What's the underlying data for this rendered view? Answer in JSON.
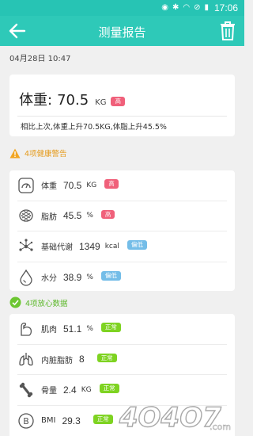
{
  "status_bar": {
    "time": "17:06"
  },
  "app_bar": {
    "title": "测量报告"
  },
  "report": {
    "datetime": "04月28日  10:47"
  },
  "summary": {
    "label": "体重:",
    "value": "70.5",
    "unit": "KG",
    "badge": "高",
    "comparison": "相比上次,体重上升70.5KG,体脂上升45.5%"
  },
  "warnings": {
    "title": "4项健康警告",
    "items": [
      {
        "name": "体重",
        "value": "70.5",
        "unit": "KG",
        "badge": "高",
        "badge_color": "#f0607a",
        "icon": "gauge-icon"
      },
      {
        "name": "脂肪",
        "value": "45.5",
        "unit": "%",
        "badge": "高",
        "badge_color": "#f0607a",
        "icon": "fat-icon"
      },
      {
        "name": "基础代谢",
        "value": "1349",
        "unit": "kcal",
        "badge": "偏低",
        "badge_color": "#74bde8",
        "icon": "metabolism-icon"
      },
      {
        "name": "水分",
        "value": "38.9",
        "unit": "%",
        "badge": "偏低",
        "badge_color": "#74bde8",
        "icon": "water-drop-icon"
      }
    ]
  },
  "normal": {
    "title": "4项放心数据",
    "items": [
      {
        "name": "肌肉",
        "value": "51.1",
        "unit": "%",
        "badge": "正常",
        "badge_color": "#7ed321",
        "icon": "muscle-icon"
      },
      {
        "name": "内脏脂肪",
        "value": "8",
        "unit": "",
        "badge": "正常",
        "badge_color": "#7ed321",
        "icon": "lungs-icon"
      },
      {
        "name": "骨量",
        "value": "2.4",
        "unit": "KG",
        "badge": "正常",
        "badge_color": "#7ed321",
        "icon": "bone-icon"
      },
      {
        "name": "BMI",
        "value": "29.3",
        "unit": "",
        "badge": "正常",
        "badge_color": "#7ed321",
        "icon": "bmi-icon"
      }
    ]
  },
  "colors": {
    "accent": "#2ec9b8",
    "warning": "#e59a1a",
    "ok": "#5cb82a"
  },
  "watermark": {
    "text": "4O4O7.com"
  }
}
